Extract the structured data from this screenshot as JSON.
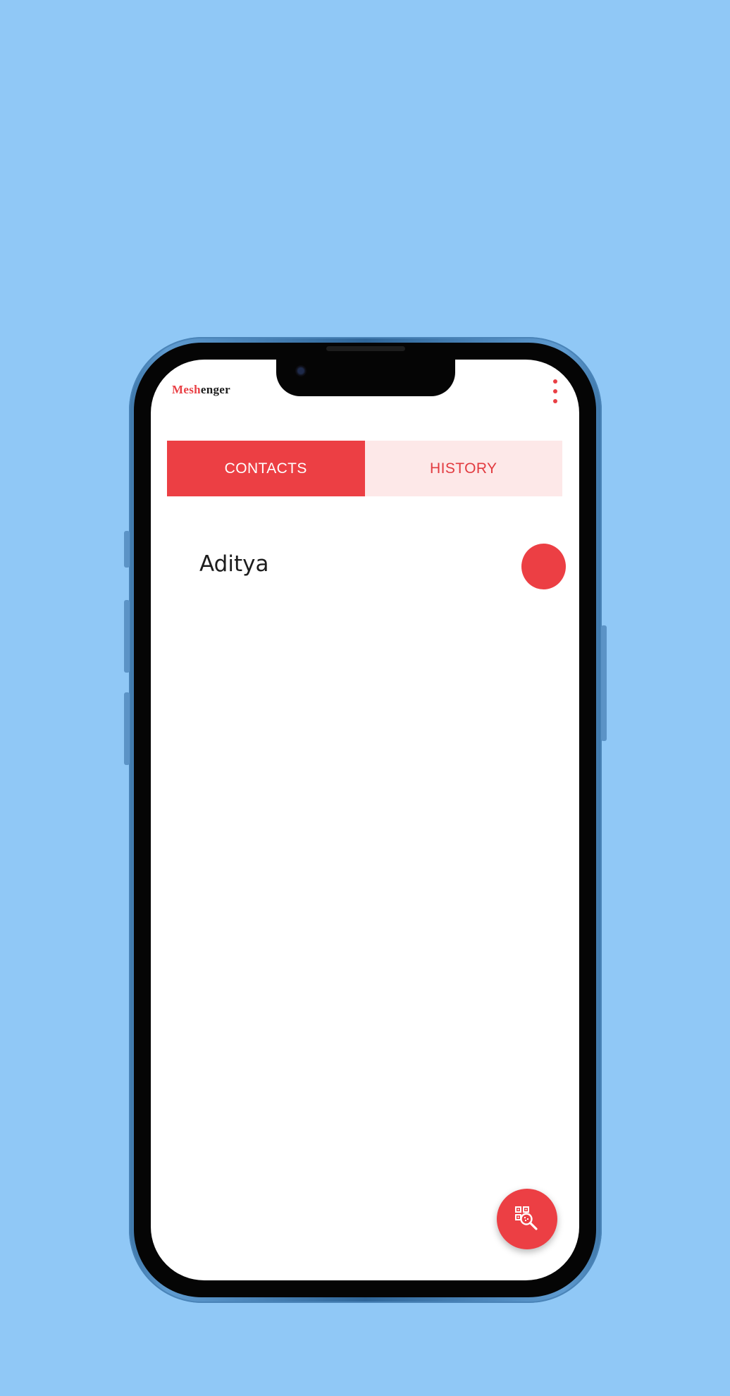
{
  "app": {
    "name_prefix": "Mesh",
    "name_suffix": "enger"
  },
  "header": {
    "menu_icon": "more-vert-icon"
  },
  "tabs": [
    {
      "label": "CONTACTS",
      "active": true
    },
    {
      "label": "HISTORY",
      "active": false
    }
  ],
  "contacts": [
    {
      "name": "Aditya",
      "status_color": "#ec3f44"
    }
  ],
  "fab": {
    "icon": "qr-search-icon"
  },
  "colors": {
    "accent": "#ec3f44",
    "tab_inactive_bg": "#fde8e8",
    "background": "#90c8f6"
  }
}
